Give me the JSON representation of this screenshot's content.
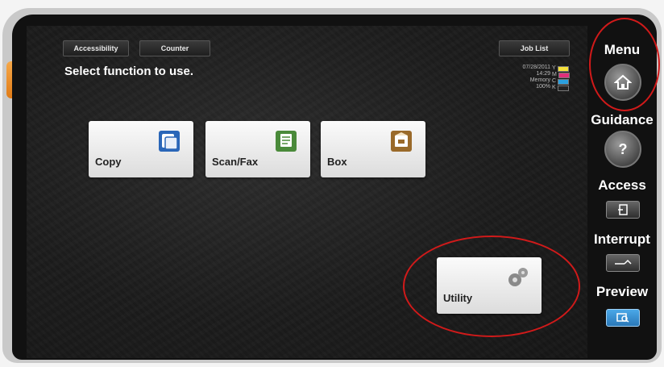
{
  "screen": {
    "buttons": {
      "accessibility": "Accessibility",
      "counter": "Counter",
      "job_list": "Job List"
    },
    "title": "Select function to use.",
    "status": {
      "date": "07/28/2011",
      "time": "14:29",
      "memory_label": "Memory",
      "memory_value": "100%"
    },
    "toner": [
      {
        "label": "Y",
        "color": "#f4e03a"
      },
      {
        "label": "M",
        "color": "#e0307a"
      },
      {
        "label": "C",
        "color": "#2aa0e0"
      },
      {
        "label": "K",
        "color": "#222222"
      }
    ],
    "tiles": {
      "copy": "Copy",
      "scan_fax": "Scan/Fax",
      "box": "Box",
      "utility": "Utility"
    }
  },
  "sidebar": {
    "menu": "Menu",
    "guidance": "Guidance",
    "guidance_symbol": "?",
    "access": "Access",
    "interrupt": "Interrupt",
    "preview": "Preview"
  },
  "colors": {
    "highlight_ring": "#d01a1a",
    "device_orange": "#e07b16",
    "preview_button": "#2f8fd0"
  }
}
